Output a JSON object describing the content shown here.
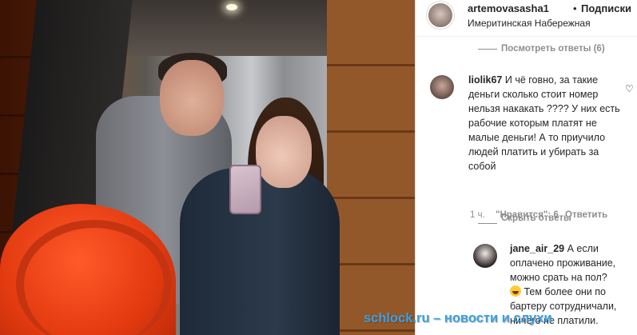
{
  "post": {
    "username": "artemovasasha1",
    "separator": "•",
    "follow_label": "Подписки",
    "location": "Имеритинская Набережная"
  },
  "thread": {
    "view_replies_label": "Посмотреть ответы (6)",
    "hide_replies_label": "Скрыть ответы"
  },
  "comments": [
    {
      "username": "liolik67",
      "text": "И чё говно, за такие деньги сколько стоит номер нельзя накакать ???? У них есть рабочие которым платят не малые деньги! А то приучило людей платить и убирать за собой",
      "lines": [
        "И чё говно, за такие",
        "деньги сколько стоит номер",
        "нельзя накакать ???? У них есть",
        "рабочие которым платят не",
        "малые деньги! А то приучило",
        "людей платить и убирать за",
        "собой"
      ],
      "time": "1 ч.",
      "likes": "\"Нравится\": 6",
      "reply_label": "Ответить"
    },
    {
      "username": "jane_air_29",
      "lines": [
        "А если",
        "оплачено проживание,",
        "можно срать на пол?",
        "Тем более они по",
        "бартеру сотрудничали,",
        "ничего не платили."
      ]
    }
  ],
  "watermark": "schlock.ru – новости и слухи",
  "colors": {
    "text": "#262626",
    "muted": "#8e8e8e",
    "watermark": "#3aa0e0"
  }
}
